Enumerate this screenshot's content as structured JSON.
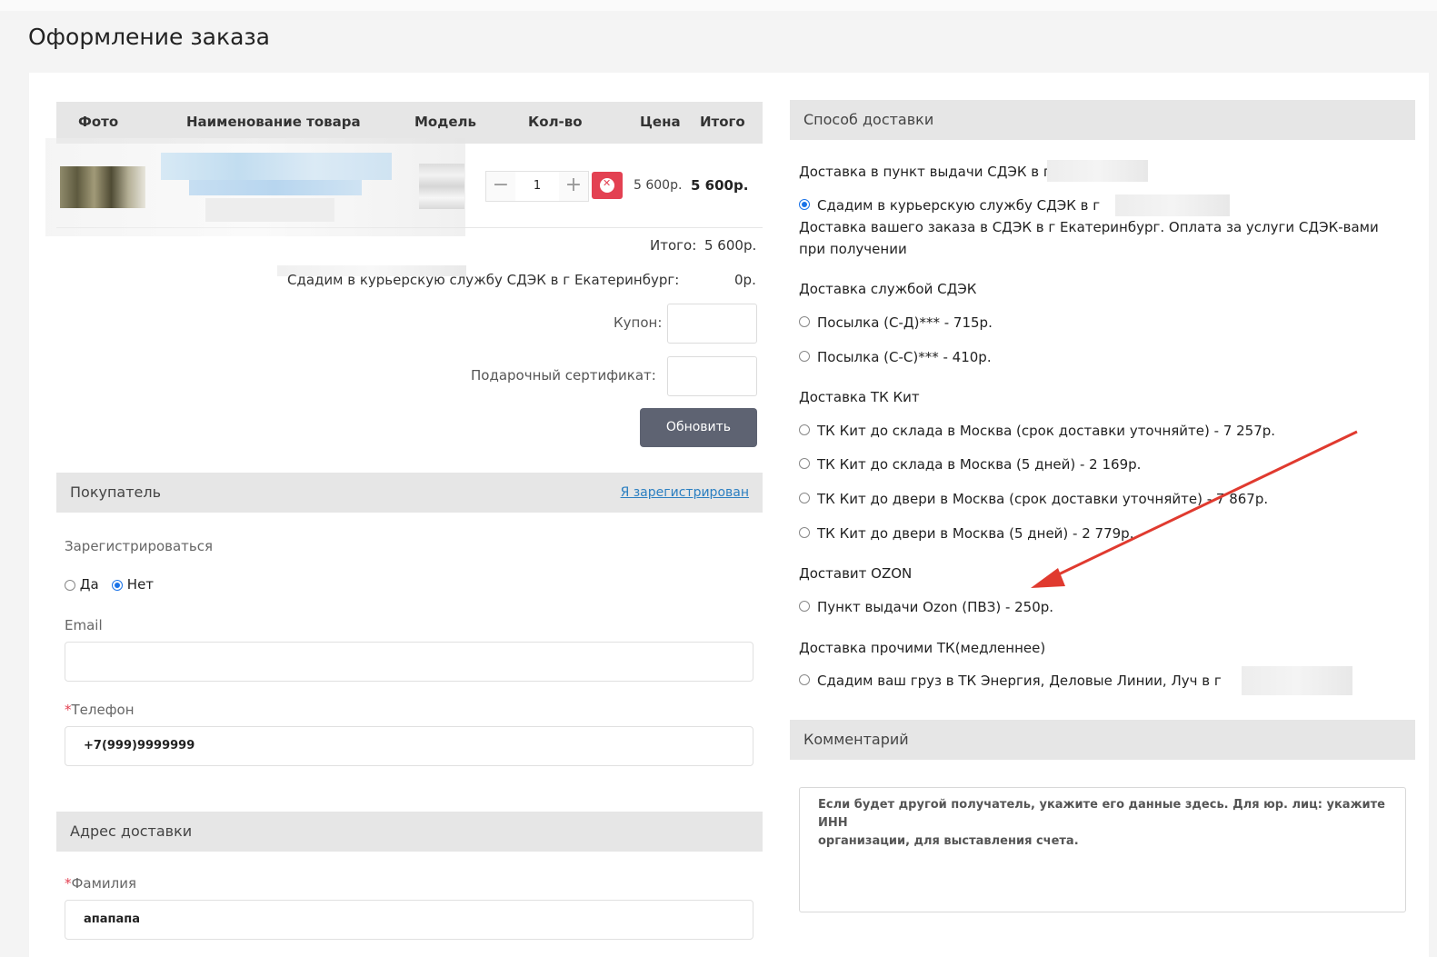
{
  "page_title": "Оформление заказа",
  "cart": {
    "columns": [
      "Фото",
      "Наименование товара",
      "Модель",
      "Кол-во",
      "Цена",
      "Итого"
    ],
    "item": {
      "quantity": "1",
      "price": "5 600р.",
      "total": "5 600р."
    },
    "subtotal_label": "Итого:",
    "subtotal_value": "5 600р.",
    "shipping_label": "Сдадим в курьерскую службу СДЭК в г Екатеринбург:",
    "shipping_value": "0р.",
    "coupon_label": "Купон:",
    "gift_label": "Подарочный сертификат:",
    "update_button": "Обновить"
  },
  "buyer": {
    "title": "Покупатель",
    "registered_link": "Я зарегистрирован",
    "register_label": "Зарегистрироваться",
    "yes": "Да",
    "no": "Нет",
    "email_label": "Email",
    "email_value": "",
    "phone_label": "Телефон",
    "phone_value": "+7(999)9999999"
  },
  "address": {
    "title": "Адрес доставки",
    "lastname_label": "Фамилия",
    "lastname_value": "апапапа"
  },
  "delivery": {
    "title": "Способ доставки",
    "groups": [
      {
        "title": "Доставка в пункт выдачи СДЭК в г",
        "options": [
          {
            "label": "Сдадим в курьерскую службу СДЭК в г",
            "checked": true,
            "note_line1": "Доставка вашего заказа в СДЭК в г Екатеринбург. Оплата за услуги СДЭК-вами",
            "note_line2": "при получении"
          }
        ]
      },
      {
        "title": "Доставка службой СДЭК",
        "options": [
          {
            "label": "Посылка (С-Д)*** - 715р.",
            "checked": false
          },
          {
            "label": "Посылка (С-С)*** - 410р.",
            "checked": false
          }
        ]
      },
      {
        "title": "Доставка ТК Кит",
        "options": [
          {
            "label": "ТК Кит до склада в Москва (срок доставки уточняйте) - 7 257р.",
            "checked": false
          },
          {
            "label": "ТК Кит до склада в Москва (5 дней) - 2 169р.",
            "checked": false
          },
          {
            "label": "ТК Кит до двери в Москва (срок доставки уточняйте) - 7 867р.",
            "checked": false
          },
          {
            "label": "ТК Кит до двери в Москва (5 дней) - 2 779р.",
            "checked": false
          }
        ]
      },
      {
        "title": "Доставит OZON",
        "options": [
          {
            "label": "Пункт выдачи Ozon (ПВЗ) - 250р.",
            "checked": false
          }
        ]
      },
      {
        "title": "Доставка прочими ТК(медленнее)",
        "options": [
          {
            "label": "Сдадим ваш груз в ТК Энергия, Деловые Линии, Луч в г",
            "checked": false
          }
        ]
      }
    ]
  },
  "comment": {
    "title": "Комментарий",
    "placeholder_line1": "Если будет другой получатель, укажите его данные здесь. Для юр. лиц: укажите ИНН",
    "placeholder_line2": "организации, для выставления счета."
  },
  "colors": {
    "accent": "#e34152",
    "button": "#5e6372",
    "link": "#2b7fc1",
    "header_bg": "#e6e6e6",
    "arrow": "#e03a2f"
  }
}
